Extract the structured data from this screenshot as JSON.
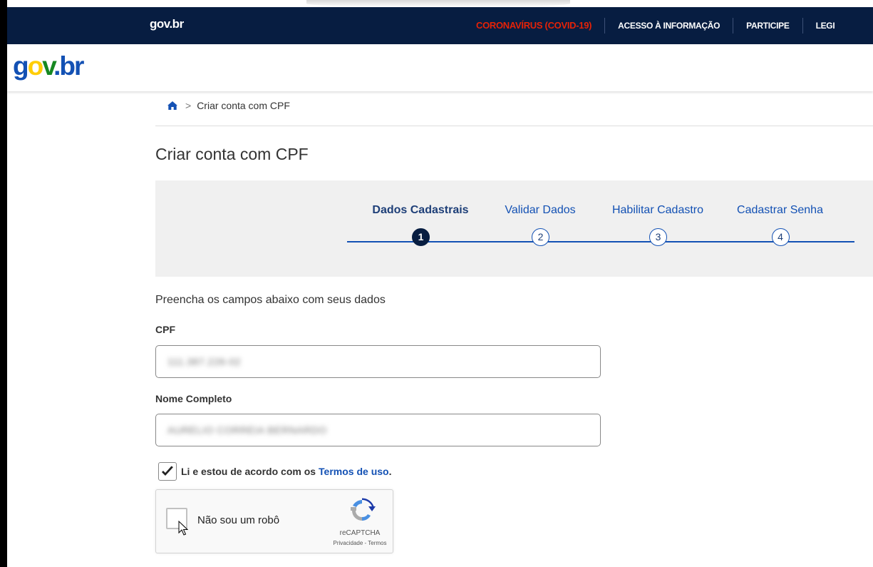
{
  "topbar": {
    "logo": "gov.br",
    "nav": [
      {
        "label": "CORONAVÍRUS (COVID-19)"
      },
      {
        "label": "ACESSO À INFORMAÇÃO"
      },
      {
        "label": "PARTICIPE"
      },
      {
        "label": "LEGI"
      }
    ]
  },
  "header": {
    "logo": "gov.br"
  },
  "breadcrumb": {
    "icon": "home-icon",
    "current": "Criar conta com CPF"
  },
  "page": {
    "title": "Criar conta com CPF"
  },
  "stepper": {
    "steps": [
      {
        "label": "Dados Cadastrais",
        "number": "1",
        "active": true
      },
      {
        "label": "Validar Dados",
        "number": "2",
        "active": false
      },
      {
        "label": "Habilitar Cadastro",
        "number": "3",
        "active": false
      },
      {
        "label": "Cadastrar Senha",
        "number": "4",
        "active": false
      }
    ]
  },
  "form": {
    "intro": "Preencha os campos abaixo com seus dados",
    "cpf": {
      "label": "CPF",
      "value": "111.387.226-02"
    },
    "nome": {
      "label": "Nome Completo",
      "value": "AURELIO CORREIA BERNARDO"
    },
    "terms": {
      "text": "Li e estou de acordo com os",
      "link": "Termos de uso",
      "suffix": ".",
      "checked": true
    }
  },
  "recaptcha": {
    "label": "Não sou um robô",
    "brand": "reCAPTCHA",
    "links": "Privacidade - Termos"
  },
  "colors": {
    "topbar": "#071d41",
    "primary": "#1351b4",
    "covid": "#e52207",
    "stepper_bg": "#f0f0f0"
  }
}
